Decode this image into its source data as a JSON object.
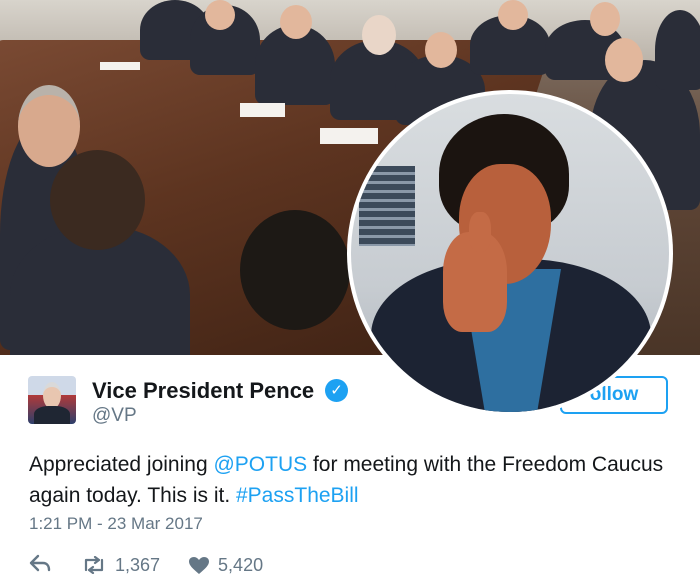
{
  "tweet": {
    "author_name": "Vice President Pence",
    "handle": "@VP",
    "follow_label": "ollow",
    "verified_glyph": "✓",
    "text_before": "Appreciated joining ",
    "mention": "@POTUS",
    "text_middle": " for meeting with the Freedom Caucus again today. This is it. ",
    "hashtag": "#PassTheBill",
    "timestamp": "1:21 PM - 23 Mar 2017",
    "retweet_count": "1,367",
    "like_count": "5,420"
  },
  "icons": {
    "reply": "reply-icon",
    "retweet": "retweet-icon",
    "like": "heart-icon",
    "verified": "verified-badge-icon"
  },
  "colors": {
    "link": "#1da1f2",
    "secondary_text": "#657786",
    "primary_text": "#14171a"
  }
}
